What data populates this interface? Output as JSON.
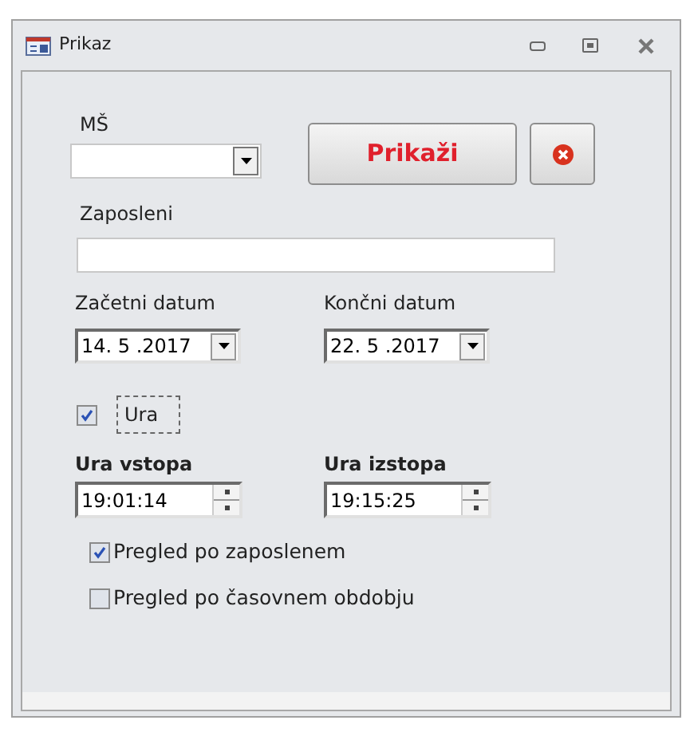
{
  "window": {
    "title": "Prikaz"
  },
  "ms": {
    "label": "MŠ"
  },
  "show_button": {
    "label": "Prikaži"
  },
  "employee": {
    "label": "Zaposleni"
  },
  "start_date": {
    "label": "Začetni datum",
    "value": "14. 5 .2017"
  },
  "end_date": {
    "label": "Končni datum",
    "value": "22. 5 .2017"
  },
  "time_toggle": {
    "label": "Ura",
    "checked": true
  },
  "entry_time": {
    "label": "Ura vstopa",
    "value": "19:01:14"
  },
  "exit_time": {
    "label": "Ura izstopa",
    "value": "19:15:25"
  },
  "options": [
    {
      "label": "Pregled po zaposlenem",
      "checked": true
    },
    {
      "label": "Pregled po časovnem obdobju",
      "checked": false
    }
  ]
}
